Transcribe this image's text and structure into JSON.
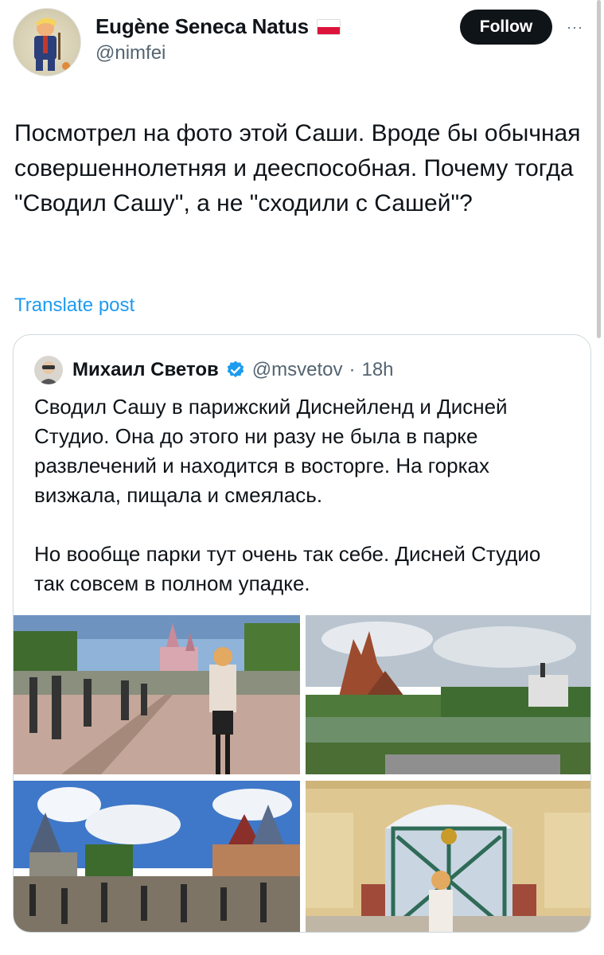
{
  "post": {
    "author_name": "Eugène Seneca Natus",
    "author_handle": "@nimfei",
    "follow_label": "Follow",
    "more_label": "···",
    "text": "Посмотрел на фото этой Саши. Вроде бы обычная совершеннолетняя и дееспособная. Почему тогда \"Сводил Сашу\", а не \"сходили с Сашей\"?",
    "translate_label": "Translate post",
    "flag_icon": "poland-flag-icon"
  },
  "quoted": {
    "author_name": "Михаил Светов",
    "author_handle": "@msvetov",
    "separator": "·",
    "time": "18h",
    "verified_icon": "verified-badge-icon",
    "text": "Сводил Сашу в парижский Диснейленд и Дисней Студио. Она до этого ни разу не была в парке развлечений и находится в восторге. На горках визжала, пищала и смеялась.\n\nНо вообще парки тут очень так себе. Дисней Студио так совсем в полном упадке.",
    "photos": [
      "photo-castle-main-street",
      "photo-big-thunder-mountain",
      "photo-fantasyland-crowd",
      "photo-studios-gate"
    ]
  },
  "colors": {
    "text": "#0f1419",
    "secondary": "#536471",
    "link": "#1d9bf0",
    "border": "#cfd9de",
    "follow_bg": "#0f1419"
  }
}
